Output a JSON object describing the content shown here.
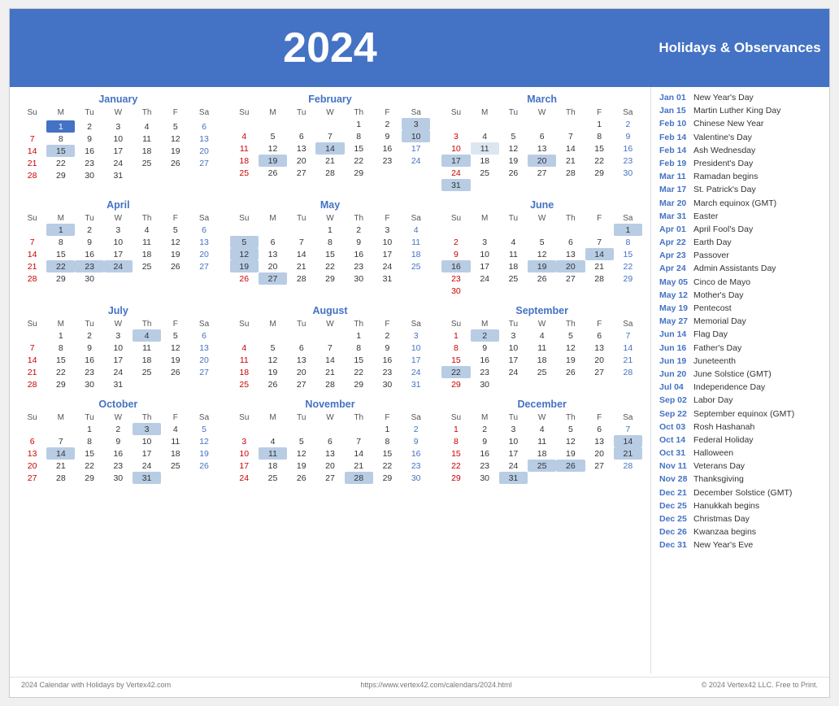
{
  "year": "2024",
  "title": "Holidays & Observances",
  "footer_left": "2024 Calendar with Holidays by Vertex42.com",
  "footer_center": "https://www.vertex42.com/calendars/2024.html",
  "footer_right": "© 2024 Vertex42 LLC. Free to Print.",
  "days_header": [
    "Su",
    "M",
    "Tu",
    "W",
    "Th",
    "F",
    "Sa"
  ],
  "months": [
    {
      "name": "January",
      "weeks": [
        [
          "",
          "",
          "",
          "",
          "",
          "",
          ""
        ],
        [
          "",
          "1",
          "2",
          "3",
          "4",
          "5",
          "6"
        ],
        [
          "7",
          "8",
          "9",
          "10",
          "11",
          "12",
          "13"
        ],
        [
          "14",
          "15",
          "16",
          "17",
          "18",
          "19",
          "20"
        ],
        [
          "21",
          "22",
          "23",
          "24",
          "25",
          "26",
          "27"
        ],
        [
          "28",
          "29",
          "30",
          "31",
          "",
          "",
          ""
        ]
      ],
      "highlights": {
        "1": "today",
        "15": "holiday"
      }
    },
    {
      "name": "February",
      "weeks": [
        [
          "",
          "",
          "",
          "",
          "1",
          "2",
          "3"
        ],
        [
          "4",
          "5",
          "6",
          "7",
          "8",
          "9",
          "10"
        ],
        [
          "11",
          "12",
          "13",
          "14",
          "15",
          "16",
          "17"
        ],
        [
          "18",
          "19",
          "20",
          "21",
          "22",
          "23",
          "24"
        ],
        [
          "25",
          "26",
          "27",
          "28",
          "29",
          "",
          ""
        ]
      ],
      "highlights": {
        "3": "sat_holiday",
        "10": "holiday",
        "14": "holiday",
        "19": "holiday"
      }
    },
    {
      "name": "March",
      "weeks": [
        [
          "",
          "",
          "",
          "",
          "",
          "1",
          "2"
        ],
        [
          "3",
          "4",
          "5",
          "6",
          "7",
          "8",
          "9"
        ],
        [
          "10",
          "11",
          "12",
          "13",
          "14",
          "15",
          "16"
        ],
        [
          "17",
          "18",
          "19",
          "20",
          "21",
          "22",
          "23"
        ],
        [
          "24",
          "25",
          "26",
          "27",
          "28",
          "29",
          "30"
        ],
        [
          "31",
          "",
          "",
          "",
          "",
          "",
          ""
        ]
      ],
      "highlights": {
        "17": "holiday",
        "20": "holiday",
        "31": "holiday",
        "11": "special"
      }
    },
    {
      "name": "April",
      "weeks": [
        [
          "",
          "1",
          "2",
          "3",
          "4",
          "5",
          "6"
        ],
        [
          "7",
          "8",
          "9",
          "10",
          "11",
          "12",
          "13"
        ],
        [
          "14",
          "15",
          "16",
          "17",
          "18",
          "19",
          "20"
        ],
        [
          "21",
          "22",
          "23",
          "24",
          "25",
          "26",
          "27"
        ],
        [
          "28",
          "29",
          "30",
          "",
          "",
          "",
          ""
        ]
      ],
      "highlights": {
        "1": "holiday",
        "22": "holiday",
        "23": "holiday",
        "24": "holiday"
      }
    },
    {
      "name": "May",
      "weeks": [
        [
          "",
          "",
          "",
          "1",
          "2",
          "3",
          "4"
        ],
        [
          "5",
          "6",
          "7",
          "8",
          "9",
          "10",
          "11"
        ],
        [
          "12",
          "13",
          "14",
          "15",
          "16",
          "17",
          "18"
        ],
        [
          "19",
          "20",
          "21",
          "22",
          "23",
          "24",
          "25"
        ],
        [
          "26",
          "27",
          "28",
          "29",
          "30",
          "31",
          ""
        ]
      ],
      "highlights": {
        "5": "holiday",
        "12": "holiday",
        "19": "holiday",
        "27": "holiday"
      }
    },
    {
      "name": "June",
      "weeks": [
        [
          "",
          "",
          "",
          "",
          "",
          "",
          "1"
        ],
        [
          "2",
          "3",
          "4",
          "5",
          "6",
          "7",
          "8"
        ],
        [
          "9",
          "10",
          "11",
          "12",
          "13",
          "14",
          "15"
        ],
        [
          "16",
          "17",
          "18",
          "19",
          "20",
          "21",
          "22"
        ],
        [
          "23",
          "24",
          "25",
          "26",
          "27",
          "28",
          "29"
        ],
        [
          "30",
          "",
          "",
          "",
          "",
          "",
          ""
        ]
      ],
      "highlights": {
        "14": "holiday",
        "16": "holiday",
        "19": "holiday",
        "20": "holiday",
        "1": "sat_holiday"
      }
    },
    {
      "name": "July",
      "weeks": [
        [
          "",
          "1",
          "2",
          "3",
          "4",
          "5",
          "6"
        ],
        [
          "7",
          "8",
          "9",
          "10",
          "11",
          "12",
          "13"
        ],
        [
          "14",
          "15",
          "16",
          "17",
          "18",
          "19",
          "20"
        ],
        [
          "21",
          "22",
          "23",
          "24",
          "25",
          "26",
          "27"
        ],
        [
          "28",
          "29",
          "30",
          "31",
          "",
          "",
          ""
        ]
      ],
      "highlights": {
        "4": "holiday"
      }
    },
    {
      "name": "August",
      "weeks": [
        [
          "",
          "",
          "",
          "",
          "1",
          "2",
          "3"
        ],
        [
          "4",
          "5",
          "6",
          "7",
          "8",
          "9",
          "10"
        ],
        [
          "11",
          "12",
          "13",
          "14",
          "15",
          "16",
          "17"
        ],
        [
          "18",
          "19",
          "20",
          "21",
          "22",
          "23",
          "24"
        ],
        [
          "25",
          "26",
          "27",
          "28",
          "29",
          "30",
          "31"
        ]
      ],
      "highlights": {}
    },
    {
      "name": "September",
      "weeks": [
        [
          "1",
          "2",
          "3",
          "4",
          "5",
          "6",
          "7"
        ],
        [
          "8",
          "9",
          "10",
          "11",
          "12",
          "13",
          "14"
        ],
        [
          "15",
          "16",
          "17",
          "18",
          "19",
          "20",
          "21"
        ],
        [
          "22",
          "23",
          "24",
          "25",
          "26",
          "27",
          "28"
        ],
        [
          "29",
          "30",
          "",
          "",
          "",
          "",
          ""
        ]
      ],
      "highlights": {
        "2": "holiday",
        "22": "holiday"
      }
    },
    {
      "name": "October",
      "weeks": [
        [
          "",
          "",
          "1",
          "2",
          "3",
          "4",
          "5"
        ],
        [
          "6",
          "7",
          "8",
          "9",
          "10",
          "11",
          "12"
        ],
        [
          "13",
          "14",
          "15",
          "16",
          "17",
          "18",
          "19"
        ],
        [
          "20",
          "21",
          "22",
          "23",
          "24",
          "25",
          "26"
        ],
        [
          "27",
          "28",
          "29",
          "30",
          "31",
          "",
          ""
        ]
      ],
      "highlights": {
        "3": "holiday",
        "14": "holiday",
        "31": "holiday"
      }
    },
    {
      "name": "November",
      "weeks": [
        [
          "",
          "",
          "",
          "",
          "",
          "1",
          "2"
        ],
        [
          "3",
          "4",
          "5",
          "6",
          "7",
          "8",
          "9"
        ],
        [
          "10",
          "11",
          "12",
          "13",
          "14",
          "15",
          "16"
        ],
        [
          "17",
          "18",
          "19",
          "20",
          "21",
          "22",
          "23"
        ],
        [
          "24",
          "25",
          "26",
          "27",
          "28",
          "29",
          "30"
        ]
      ],
      "highlights": {
        "11": "holiday",
        "28": "holiday"
      }
    },
    {
      "name": "December",
      "weeks": [
        [
          "1",
          "2",
          "3",
          "4",
          "5",
          "6",
          "7"
        ],
        [
          "8",
          "9",
          "10",
          "11",
          "12",
          "13",
          "14"
        ],
        [
          "15",
          "16",
          "17",
          "18",
          "19",
          "20",
          "21"
        ],
        [
          "22",
          "23",
          "24",
          "25",
          "26",
          "27",
          "28"
        ],
        [
          "29",
          "30",
          "31",
          "",
          "",
          "",
          ""
        ]
      ],
      "highlights": {
        "21": "holiday",
        "25": "holiday",
        "26": "holiday",
        "31": "holiday",
        "14": "holiday"
      }
    }
  ],
  "holidays": [
    {
      "date": "Jan 01",
      "name": "New Year's Day"
    },
    {
      "date": "Jan 15",
      "name": "Martin Luther King Day"
    },
    {
      "date": "Feb 10",
      "name": "Chinese New Year"
    },
    {
      "date": "Feb 14",
      "name": "Valentine's Day"
    },
    {
      "date": "Feb 14",
      "name": "Ash Wednesday"
    },
    {
      "date": "Feb 19",
      "name": "President's Day"
    },
    {
      "date": "Mar 11",
      "name": "Ramadan begins"
    },
    {
      "date": "Mar 17",
      "name": "St. Patrick's Day"
    },
    {
      "date": "Mar 20",
      "name": "March equinox (GMT)"
    },
    {
      "date": "Mar 31",
      "name": "Easter"
    },
    {
      "date": "Apr 01",
      "name": "April Fool's Day"
    },
    {
      "date": "Apr 22",
      "name": "Earth Day"
    },
    {
      "date": "Apr 23",
      "name": "Passover"
    },
    {
      "date": "Apr 24",
      "name": "Admin Assistants Day"
    },
    {
      "date": "May 05",
      "name": "Cinco de Mayo"
    },
    {
      "date": "May 12",
      "name": "Mother's Day"
    },
    {
      "date": "May 19",
      "name": "Pentecost"
    },
    {
      "date": "May 27",
      "name": "Memorial Day"
    },
    {
      "date": "Jun 14",
      "name": "Flag Day"
    },
    {
      "date": "Jun 16",
      "name": "Father's Day"
    },
    {
      "date": "Jun 19",
      "name": "Juneteenth"
    },
    {
      "date": "Jun 20",
      "name": "June Solstice (GMT)"
    },
    {
      "date": "Jul 04",
      "name": "Independence Day"
    },
    {
      "date": "Sep 02",
      "name": "Labor Day"
    },
    {
      "date": "Sep 22",
      "name": "September equinox (GMT)"
    },
    {
      "date": "Oct 03",
      "name": "Rosh Hashanah"
    },
    {
      "date": "Oct 14",
      "name": "Federal Holiday"
    },
    {
      "date": "Oct 31",
      "name": "Halloween"
    },
    {
      "date": "Nov 11",
      "name": "Veterans Day"
    },
    {
      "date": "Nov 28",
      "name": "Thanksgiving"
    },
    {
      "date": "Dec 21",
      "name": "December Solstice (GMT)"
    },
    {
      "date": "Dec 25",
      "name": "Hanukkah begins"
    },
    {
      "date": "Dec 25",
      "name": "Christmas Day"
    },
    {
      "date": "Dec 26",
      "name": "Kwanzaa begins"
    },
    {
      "date": "Dec 31",
      "name": "New Year's Eve"
    }
  ]
}
